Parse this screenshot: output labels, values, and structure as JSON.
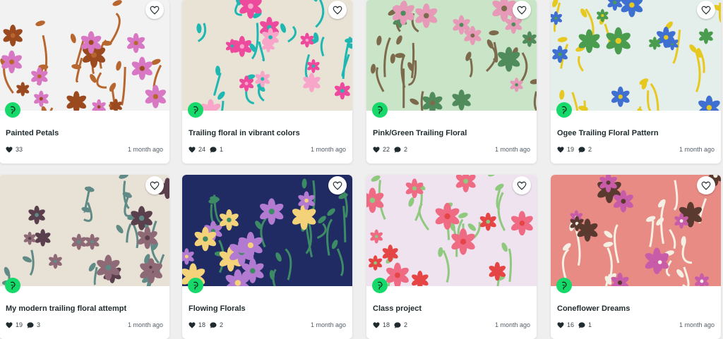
{
  "cards": [
    {
      "title": "Painted Petals",
      "likes": "33",
      "comments": "",
      "time": "1 month ago",
      "colors": {
        "bg": "#f3f2f2",
        "a": "#d877c3",
        "b": "#b8662f",
        "c": "#9a4a1e"
      }
    },
    {
      "title": "Trailing floral in vibrant colors",
      "likes": "24",
      "comments": "1",
      "time": "1 month ago",
      "colors": {
        "bg": "#e9e3d6",
        "a": "#ee4a9d",
        "b": "#1fb7b2",
        "c": "#f7a6c9"
      }
    },
    {
      "title": "Pink/Green Trailing Floral",
      "likes": "22",
      "comments": "2",
      "time": "1 month ago",
      "colors": {
        "bg": "#c9e4c6",
        "a": "#e79ab7",
        "b": "#7d6a4d",
        "c": "#4f8b5b"
      }
    },
    {
      "title": "Ogee Trailing Floral Pattern",
      "likes": "19",
      "comments": "2",
      "time": "1 month ago",
      "colors": {
        "bg": "#e4eeea",
        "a": "#3e6fd1",
        "b": "#e7c81f",
        "c": "#4a9d4f"
      }
    },
    {
      "title": "My modern trailing floral attempt",
      "likes": "19",
      "comments": "3",
      "time": "1 month ago",
      "colors": {
        "bg": "#e8e1d6",
        "a": "#8e6a76",
        "b": "#5f8a86",
        "c": "#5a3f4d"
      }
    },
    {
      "title": "Flowing Florals",
      "likes": "18",
      "comments": "2",
      "time": "1 month ago",
      "colors": {
        "bg": "#202a63",
        "a": "#b37ad1",
        "b": "#3d8b64",
        "c": "#f3d27a"
      }
    },
    {
      "title": "Class project",
      "likes": "18",
      "comments": "2",
      "time": "1 month ago",
      "colors": {
        "bg": "#efe3f0",
        "a": "#ef6b84",
        "b": "#8fc97d",
        "c": "#e64545"
      }
    },
    {
      "title": "Coneflower Dreams",
      "likes": "16",
      "comments": "1",
      "time": "1 month ago",
      "colors": {
        "bg": "#e98b85",
        "a": "#c95ca9",
        "b": "#f4f0e4",
        "c": "#5a3a2f"
      }
    }
  ],
  "icons": {
    "like": "heart-icon",
    "comment": "speech-bubble-icon",
    "favorite": "heart-outline-icon",
    "creator": "avatar-icon"
  }
}
